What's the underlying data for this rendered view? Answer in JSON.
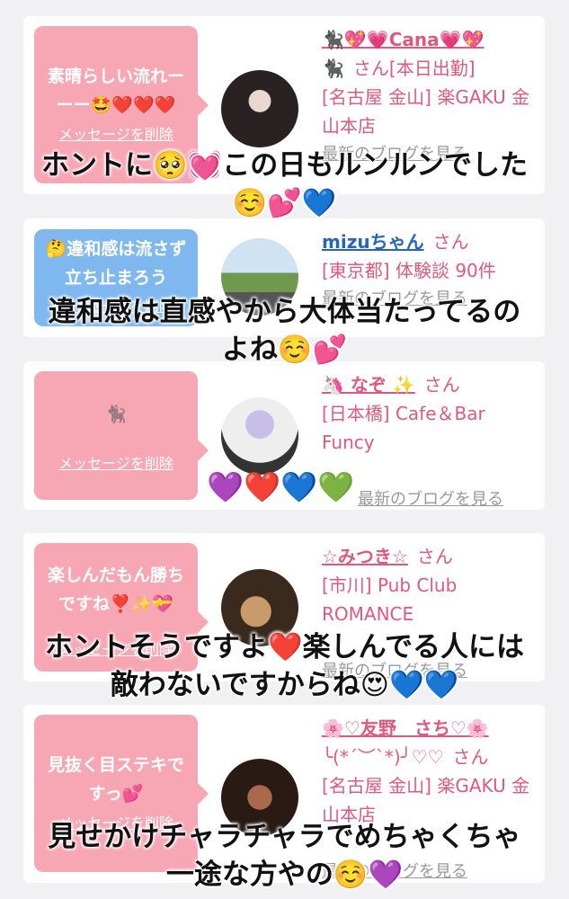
{
  "cards": [
    {
      "bubble": "素晴らしい流れー\nーー🤩❤️❤️❤️",
      "delete": "メッセージを削除",
      "name": "🐈‍⬛💖💗Cana💗💖",
      "name2": "🐈‍⬛",
      "san": "さん[本日出勤]",
      "shop": "[名古屋 金山] 楽GAKU 金山本店",
      "blog": "最新のブログを見る"
    },
    {
      "bubble": "🤔違和感は流さず立ち止まろう",
      "delete": "メッセージを削除",
      "name": "mizuちゃん",
      "san": "さん",
      "shop": "[東京都] 体験談 90件",
      "blog": "最新のブログを見る"
    },
    {
      "bubble": "",
      "bubble_icon": "🐈‍⬛",
      "delete": "メッセージを削除",
      "name": "🦄 なぞ ✨",
      "san": "さん",
      "shop": "[日本橋] Cafe＆Bar Funcy",
      "blog": "最新のブログを見る"
    },
    {
      "bubble": "楽しんだもん勝ちですね❣️✨💝",
      "delete": "メッセージを削除",
      "name": "☆みつき☆",
      "san": "さん",
      "shop": "[市川] Pub Club ROMANCE",
      "blog": "最新のブログを見る"
    },
    {
      "bubble": "見抜く目ステキですっ💕",
      "delete": "メッセージを削除",
      "name": "🌸♡友野　さち♡🌸",
      "name2": "╰(*´︶`*)╯♡♡",
      "san": "さん",
      "shop": "[名古屋 金山] 楽GAKU 金山本店",
      "blog": "最新のブログを見る"
    }
  ],
  "captions": {
    "c1a": "ホントに🥺💓この日もルンルンでした",
    "c1b": "☺️💕💙",
    "c2a": "違和感は直感やから大体当たってるの",
    "c2b": "よね☺️💕",
    "c3": "💜❤️💙💚",
    "c4a": "ホントそうですよ❤️楽しんでる人には",
    "c4b": "敵わないですからね😍💙💙",
    "c5a": "見せかけチャラチャラでめちゃくちゃ",
    "c5b": "一途な方やの☺️💜"
  },
  "colors": {
    "pink_bubble": "#f7a6b4",
    "blue_bubble": "#7fb8ef",
    "name_pink": "#e0587e",
    "name_blue": "#2466b8"
  }
}
